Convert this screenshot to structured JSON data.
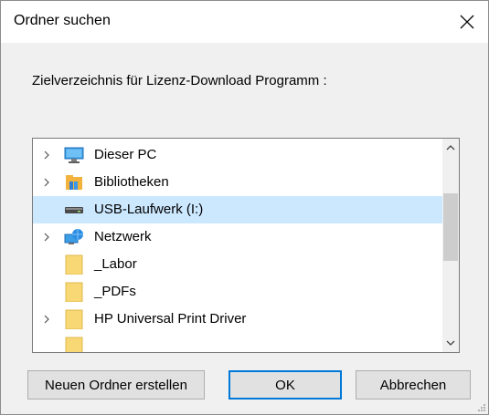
{
  "dialog": {
    "title": "Ordner suchen",
    "description": "Zielverzeichnis für Lizenz-Download Programm :"
  },
  "tree": {
    "items": [
      {
        "label": "Dieser PC",
        "icon": "computer-icon",
        "expandable": true,
        "selected": false
      },
      {
        "label": "Bibliotheken",
        "icon": "libraries-icon",
        "expandable": true,
        "selected": false
      },
      {
        "label": "USB-Laufwerk (I:)",
        "icon": "usb-drive-icon",
        "expandable": false,
        "selected": true
      },
      {
        "label": "Netzwerk",
        "icon": "network-icon",
        "expandable": true,
        "selected": false
      },
      {
        "label": "_Labor",
        "icon": "folder-icon",
        "expandable": false,
        "selected": false
      },
      {
        "label": "_PDFs",
        "icon": "folder-icon",
        "expandable": false,
        "selected": false
      },
      {
        "label": "HP Universal Print Driver",
        "icon": "folder-icon",
        "expandable": true,
        "selected": false
      }
    ]
  },
  "buttons": {
    "new_folder": "Neuen Ordner erstellen",
    "ok": "OK",
    "cancel": "Abbrechen"
  },
  "colors": {
    "selection": "#cce8ff",
    "default_button_border": "#0078d7",
    "folder": "#f8d775"
  }
}
